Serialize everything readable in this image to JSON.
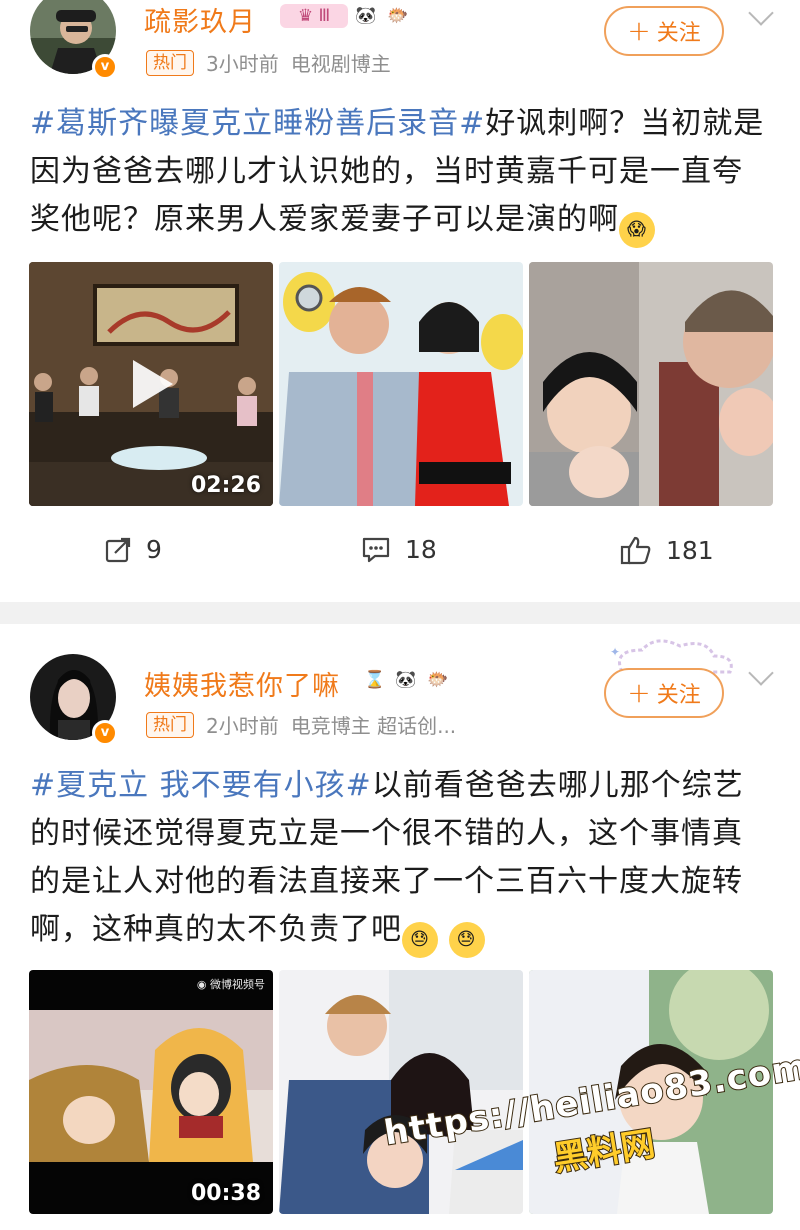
{
  "posts": [
    {
      "username": "疏影玖月",
      "hot_tag": "热门",
      "time": "3小时前",
      "role": "电视剧博主",
      "follow_label": "关注",
      "follow_plus": "+",
      "topic": "#葛斯齐曝夏克立睡粉善后录音#",
      "text": "好讽刺啊？当初就是因为爸爸去哪儿才认识她的，当时黄嘉千可是一直夸奖他呢？原来男人爱家爱妻子可以是演的啊",
      "video_duration": "02:26",
      "repost_count": "9",
      "comment_count": "18",
      "like_count": "181"
    },
    {
      "username": "姨姨我惹你了嘛",
      "hot_tag": "热门",
      "time": "2小时前",
      "role": "电竞博主 超话创...",
      "follow_label": "关注",
      "follow_plus": "+",
      "topic": "#夏克立 我不要有小孩#",
      "text": "以前看爸爸去哪儿那个综艺的时候还觉得夏克立是一个很不错的人，这个事情真的是让人对他的看法直接来了一个三百六十度大旋转啊，这种真的太不负责了吧",
      "video_duration": "00:38",
      "video_source": "微博视频号"
    }
  ],
  "watermark": {
    "url": "https://heiliao83.com",
    "name": "黑料网"
  },
  "colors": {
    "accent": "#f07a1a",
    "topic": "#4a77bd"
  }
}
